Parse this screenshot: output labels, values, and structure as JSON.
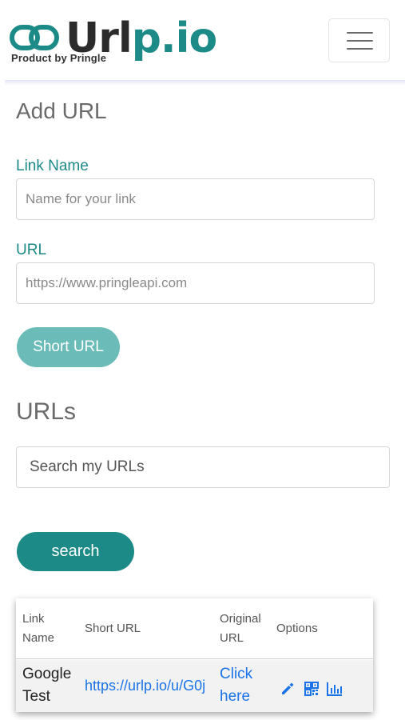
{
  "header": {
    "logo_text_a": "Url",
    "logo_text_b": "p.io",
    "tagline": "Product by Pringle",
    "menu_icon": "hamburger-menu-icon",
    "brand_color": "#1c8a86"
  },
  "add_url": {
    "title": "Add URL",
    "link_name_label": "Link Name",
    "link_name_placeholder": "Name for your link",
    "url_label": "URL",
    "url_placeholder": "https://www.pringleapi.com",
    "submit_label": "Short URL"
  },
  "urls": {
    "title": "URLs",
    "search_placeholder": "Search my URLs",
    "search_button": "search",
    "table": {
      "headers": {
        "link_name": "Link Name",
        "short_url": "Short URL",
        "original_url": "Original URL",
        "options": "Options"
      },
      "rows": [
        {
          "link_name": "Google Test",
          "short_url": "https://urlp.io/u/G0j",
          "original_url": "Click here",
          "options": [
            "pencil-edit-icon",
            "qr-code-icon",
            "bar-chart-icon"
          ]
        }
      ]
    }
  }
}
